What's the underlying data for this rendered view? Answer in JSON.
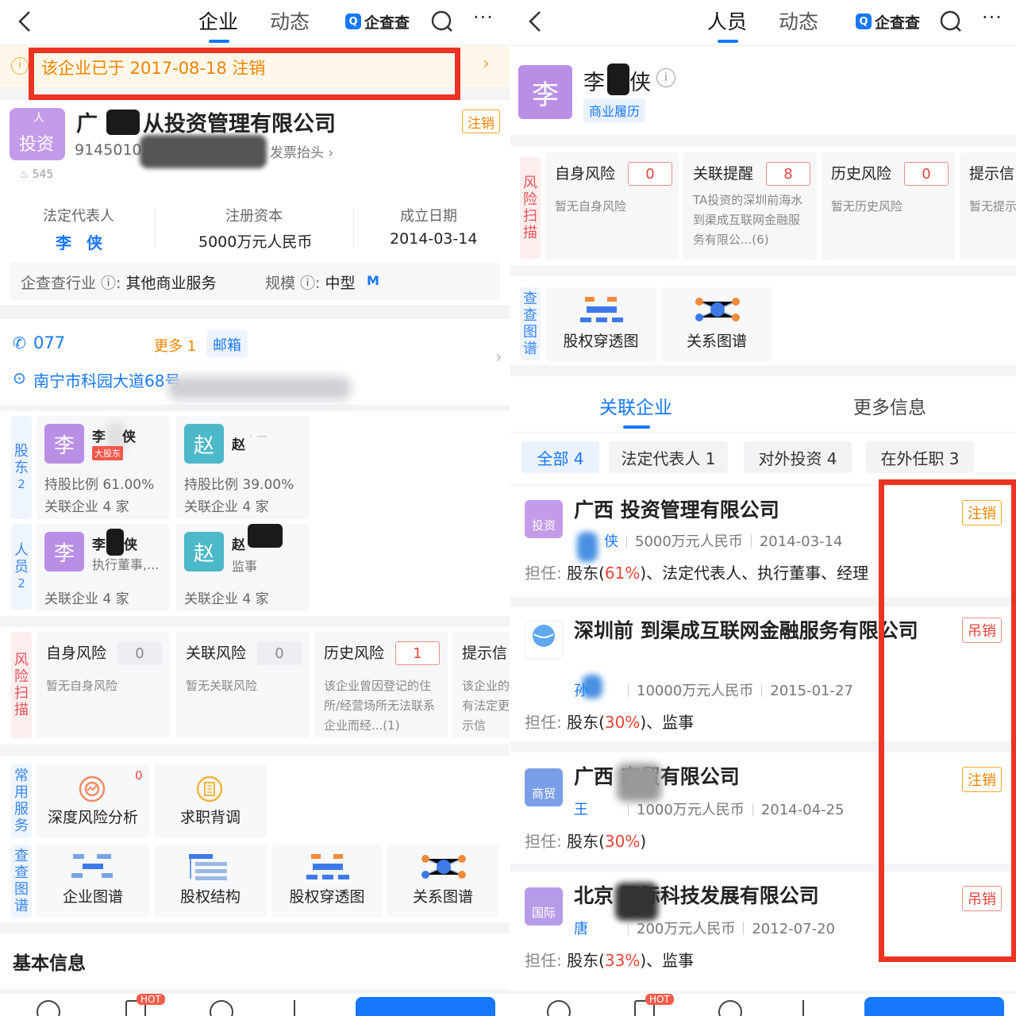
{
  "left": {
    "nav": {
      "tabs": [
        "企业",
        "动态"
      ],
      "brand": "企查查"
    },
    "notice": "该企业已于 2017-08-18 注销",
    "company": {
      "name_left": "广",
      "name_right": "从投资管理有限公司",
      "logo_text": "投资",
      "logo_text_top": "人",
      "status": "注销",
      "code": "9145010",
      "invoice": "发票抬头",
      "heat": "545"
    },
    "info": [
      {
        "label": "法定代表人",
        "value": "李  侠"
      },
      {
        "label": "注册资本",
        "value": "5000万元人民币"
      },
      {
        "label": "成立日期",
        "value": "2014-03-14"
      }
    ],
    "industry": {
      "label": "企查查行业",
      "value": "其他商业服务",
      "scale_label": "规模",
      "scale_value": "中型",
      "scale_badge": "M"
    },
    "contact": {
      "phone": "077",
      "more": "更多 1",
      "email": "邮箱",
      "address": "南宁市科园大道68号"
    },
    "shareholder_label": [
      "股",
      "东",
      "2"
    ],
    "personnel_label": [
      "人",
      "员",
      "2"
    ],
    "shareholders": [
      {
        "avatar": "李",
        "name": "李",
        "name_tail": "侠",
        "tag": "大股东",
        "l1": "持股比例 61.00%",
        "l2": "关联企业 4 家"
      },
      {
        "avatar": "赵",
        "name": "赵",
        "name_tail": "",
        "l1": "持股比例 39.00%",
        "l2": "关联企业 4 家"
      }
    ],
    "personnel": [
      {
        "avatar": "李",
        "name": "李",
        "name_tail": "侠",
        "role": "执行董事,...",
        "l2": "关联企业 4 家"
      },
      {
        "avatar": "赵",
        "name": "赵",
        "name_tail": "",
        "role": "监事",
        "l2": "关联企业 4 家"
      }
    ],
    "risk_label": [
      "风",
      "险",
      "扫",
      "描"
    ],
    "risks": [
      {
        "title": "自身风险",
        "count": "0",
        "desc": "暂无自身风险"
      },
      {
        "title": "关联风险",
        "count": "0",
        "desc": "暂无关联风险"
      },
      {
        "title": "历史风险",
        "count": "1",
        "desc": "该企业曾因登记的住所/经营场所无法联系企业而经...(1)"
      },
      {
        "title": "提示信",
        "count": "",
        "desc": "该企业的军有法定更提示信"
      }
    ],
    "services_label": [
      "常",
      "用",
      "服",
      "务"
    ],
    "services": [
      {
        "label": "深度风险分析",
        "badge": "0"
      },
      {
        "label": "求职背调"
      }
    ],
    "graph_label": [
      "查",
      "查",
      "图",
      "谱"
    ],
    "graphs": [
      "企业图谱",
      "股权结构",
      "股权穿透图",
      "关系图谱"
    ],
    "section_title": "基本信息",
    "hot": "HOT"
  },
  "right": {
    "nav": {
      "tabs": [
        "人员",
        "动态"
      ],
      "brand": "企查查"
    },
    "person": {
      "avatar": "李",
      "name_head": "李",
      "name_tail": "侠",
      "tag": "商业履历"
    },
    "risk_label": [
      "风",
      "险",
      "扫",
      "描"
    ],
    "risks": [
      {
        "title": "自身风险",
        "count": "0",
        "desc": "暂无自身风险"
      },
      {
        "title": "关联提醒",
        "count": "8",
        "desc": "TA投资的深圳前海水到渠成互联网金融服务有限公...(6)"
      },
      {
        "title": "历史风险",
        "count": "0",
        "desc": "暂无历史风险"
      },
      {
        "title": "提示信",
        "count": "",
        "desc": "暂无提示"
      }
    ],
    "graph_label": [
      "查",
      "查",
      "图",
      "谱"
    ],
    "graphs": [
      "股权穿透图",
      "关系图谱"
    ],
    "tabs": [
      "关联企业",
      "更多信息"
    ],
    "chips": [
      "全部 4",
      "法定代表人 1",
      "对外投资 4",
      "在外任职 3"
    ],
    "companies": [
      {
        "logo": "投资",
        "name": "广西 投资管理有限公司",
        "status": "注销",
        "person": "侠",
        "capital": "5000万元人民币",
        "date": "2014-03-14",
        "role_key": "担任:",
        "role_a": "股东(",
        "pct": "61%",
        "role_b": ")、法定代表人、执行董事、经理"
      },
      {
        "logo": "",
        "name": "深圳前 到渠成互联网金融服务有限公司",
        "status": "吊销",
        "person": "孙",
        "capital": "10000万元人民币",
        "date": "2015-01-27",
        "role_key": "担任:",
        "role_a": "股东(",
        "pct": "30%",
        "role_b": ")、监事"
      },
      {
        "logo": "商贸",
        "name": "广西 商贸有限公司",
        "status": "注销",
        "person": "王",
        "capital": "1000万元人民币",
        "date": "2014-04-25",
        "role_key": "担任:",
        "role_a": "股东(",
        "pct": "30%",
        "role_b": ")"
      },
      {
        "logo": "国际",
        "name": "北京 国际科技发展有限公司",
        "status": "吊销",
        "person": "唐",
        "capital": "200万元人民币",
        "date": "2012-07-20",
        "role_key": "担任:",
        "role_a": "股东(",
        "pct": "33%",
        "role_b": ")、监事"
      }
    ],
    "hot": "HOT"
  }
}
